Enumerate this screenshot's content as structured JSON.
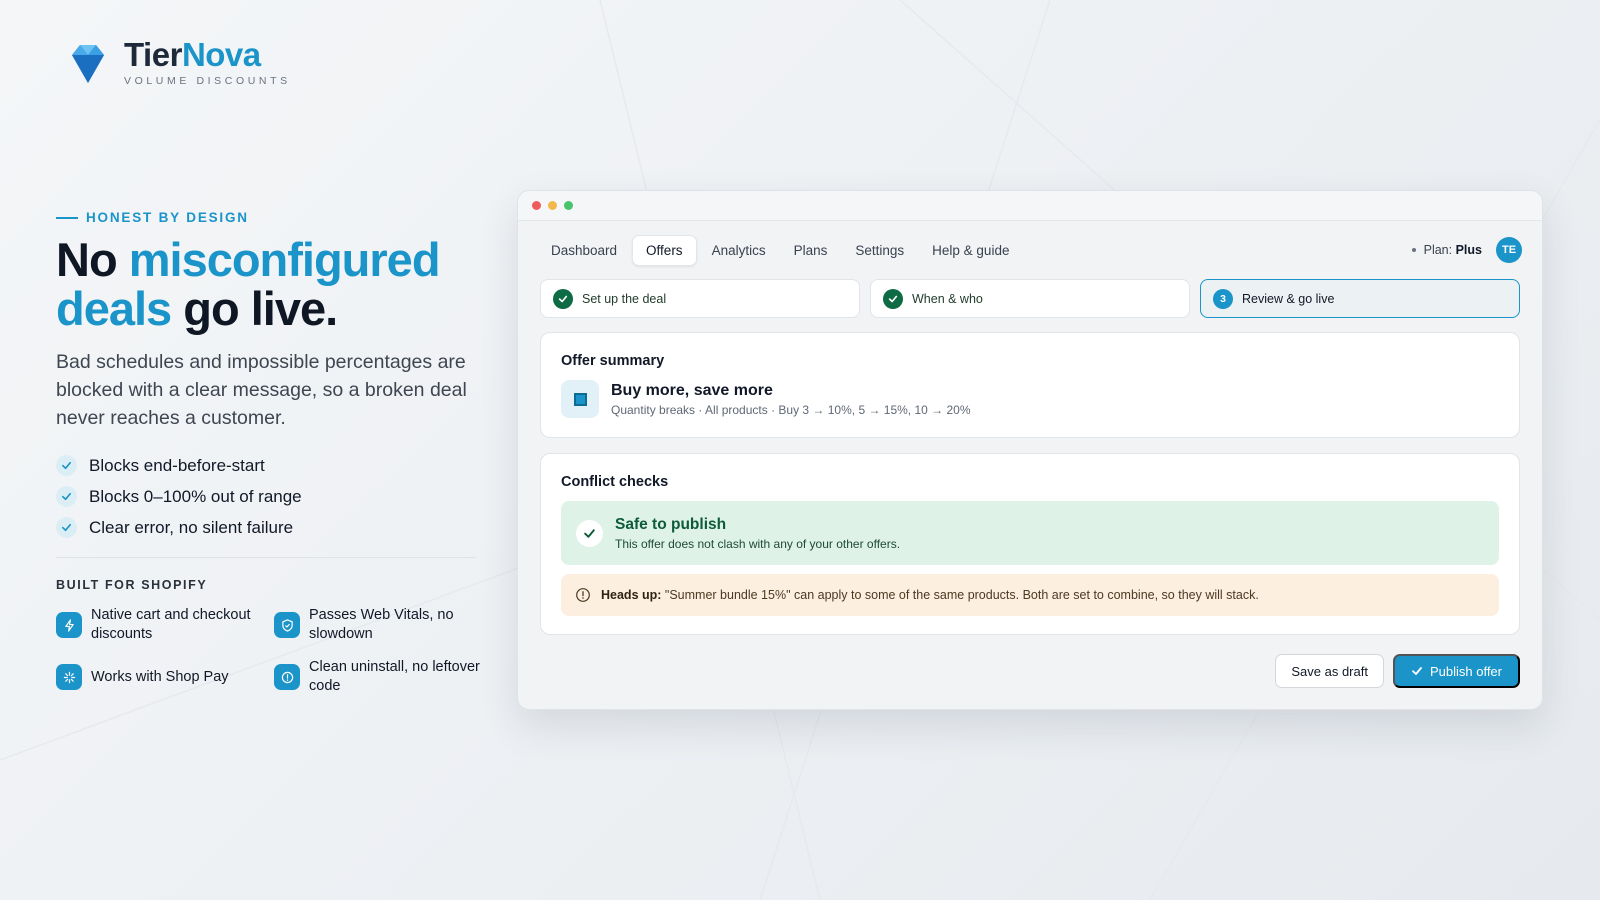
{
  "brand": {
    "name_part1": "Tier",
    "name_part2": "Nova",
    "tagline": "VOLUME DISCOUNTS",
    "colors": {
      "primary": "#1a94c9",
      "dark": "#1e2a3a"
    }
  },
  "hero": {
    "eyebrow": "HONEST BY DESIGN",
    "headline_1": "No ",
    "headline_accent_1": "misconfigured",
    "headline_accent_2": "deals",
    "headline_2": " go live.",
    "lede": "Bad schedules and impossible percentages are blocked with a clear message, so a broken deal never reaches a customer.",
    "checks": [
      "Blocks end-before-start",
      "Blocks 0–100% out of range",
      "Clear error, no silent failure"
    ],
    "built_title": "BUILT FOR SHOPIFY",
    "features": [
      {
        "label": "Native cart and checkout discounts",
        "icon": "lightning-icon"
      },
      {
        "label": "Passes Web Vitals, no slowdown",
        "icon": "shield-check-icon"
      },
      {
        "label": "Works with Shop Pay",
        "icon": "sparkle-icon"
      },
      {
        "label": "Clean uninstall, no leftover code",
        "icon": "info-circle-icon"
      }
    ]
  },
  "app": {
    "tabs": [
      "Dashboard",
      "Offers",
      "Analytics",
      "Plans",
      "Settings",
      "Help & guide"
    ],
    "active_tab": "Offers",
    "plan_label": "Plan:",
    "plan_value": "Plus",
    "avatar_initials": "TE",
    "steps": [
      {
        "label": "Set up the deal",
        "state": "done"
      },
      {
        "label": "When & who",
        "state": "done"
      },
      {
        "label": "Review & go live",
        "state": "current",
        "number": "3"
      }
    ],
    "summary": {
      "title": "Offer summary",
      "offer_name": "Buy more, save more",
      "offer_desc": "Quantity breaks · All products · Buy 3 → 10%, 5 → 15%, 10 → 20%"
    },
    "conflicts": {
      "title": "Conflict checks",
      "safe_title": "Safe to publish",
      "safe_desc": "This offer does not clash with any of your other offers.",
      "heads_label": "Heads up:",
      "heads_text": " \"Summer bundle 15%\" can apply to some of the same products. Both are set to combine, so they will stack."
    },
    "actions": {
      "draft_label": "Save as draft",
      "publish_label": "Publish offer"
    }
  }
}
